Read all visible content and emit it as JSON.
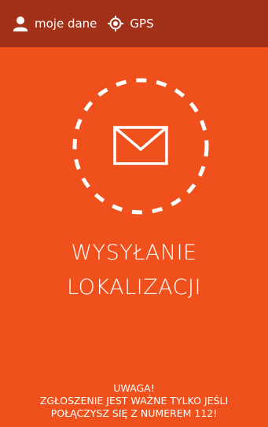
{
  "topbar": {
    "my_data_label": "moje dane",
    "my_data_icon": "user-icon",
    "gps_label": "GPS",
    "gps_icon": "gps-target-icon"
  },
  "status": {
    "icon": "envelope-icon",
    "title_line1": "WYSYŁANIE",
    "title_line2": "LOKALIZACJI"
  },
  "warning": {
    "heading": "UWAGA!",
    "line1": "ZGŁOSZENIE JEST WAŻNE TYLKO JEŚLI",
    "line2": "POŁĄCZYSZ SIĘ Z NUMEREM 112!"
  },
  "colors": {
    "background": "#f0501c",
    "topbar": "#a3311a",
    "foreground": "#ffffff"
  }
}
